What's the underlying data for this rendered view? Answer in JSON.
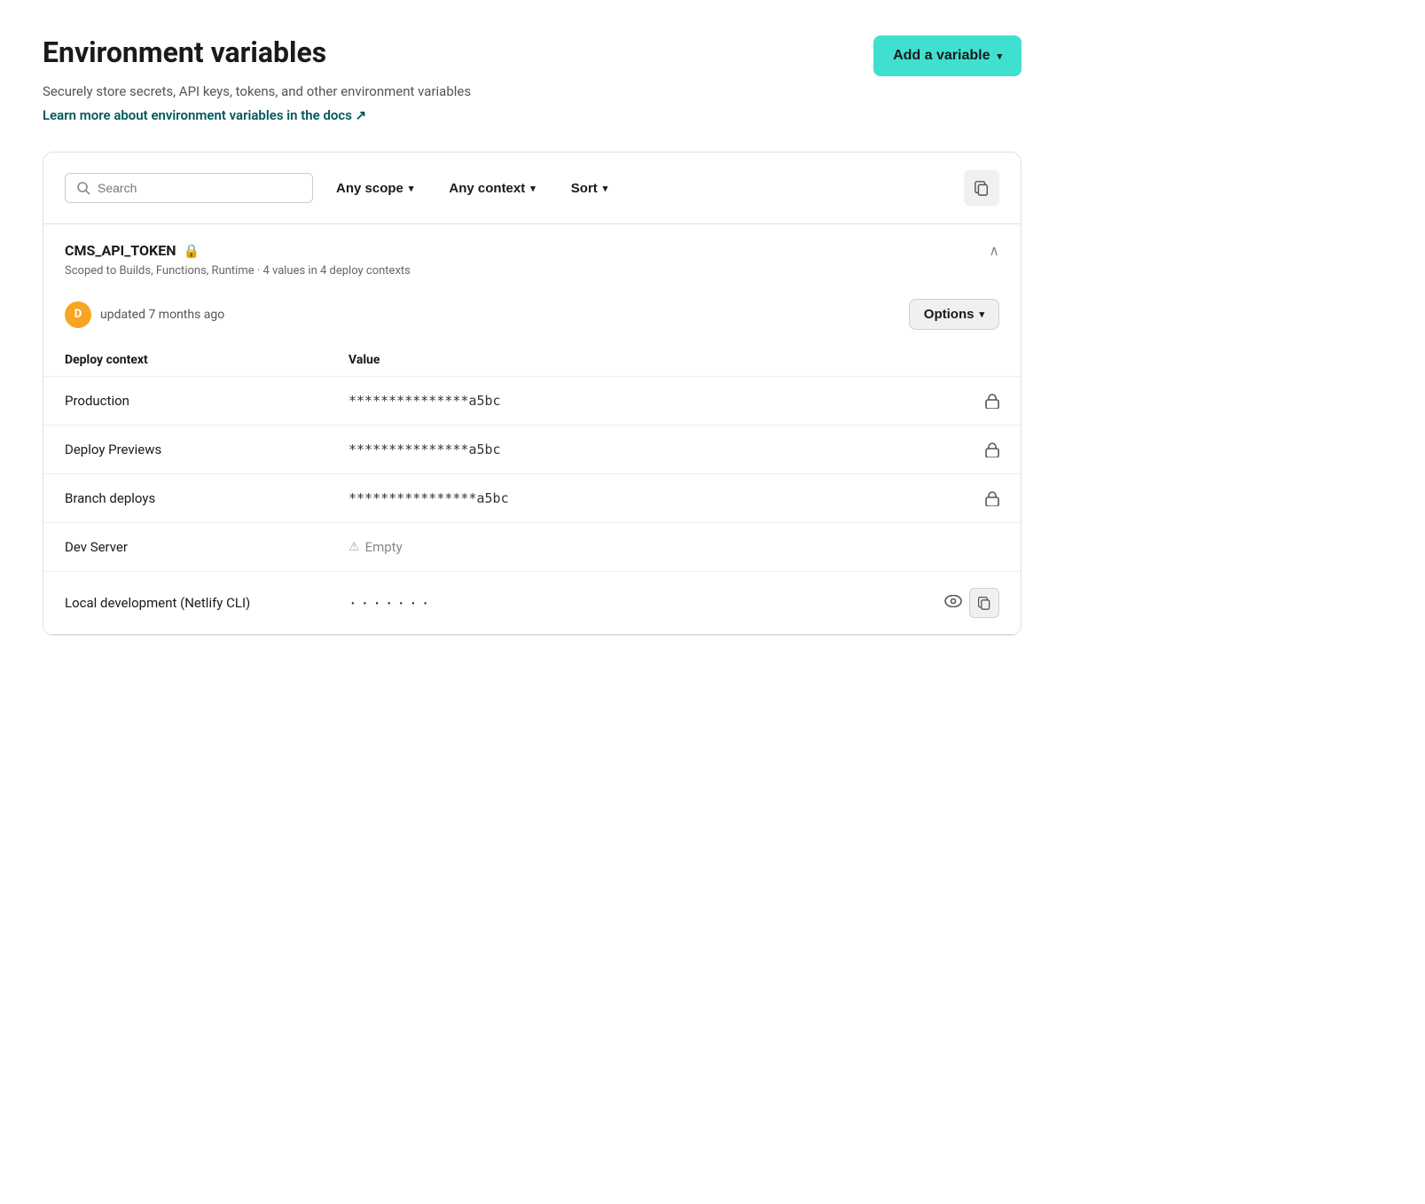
{
  "page": {
    "title": "Environment variables",
    "description": "Securely store secrets, API keys, tokens, and other environment variables",
    "docs_link": "Learn more about environment variables in the docs ↗",
    "add_button": "Add a variable"
  },
  "filter_bar": {
    "search_placeholder": "Search",
    "scope_label": "Any scope",
    "context_label": "Any context",
    "sort_label": "Sort"
  },
  "variable": {
    "name": "CMS_API_TOKEN",
    "meta": "Scoped to Builds, Functions, Runtime · 4 values in 4 deploy contexts",
    "updated_text": "updated 7 months ago",
    "avatar_initial": "D",
    "options_label": "Options",
    "table": {
      "col_context": "Deploy context",
      "col_value": "Value",
      "rows": [
        {
          "context": "Production",
          "value": "***************a5bc",
          "type": "locked"
        },
        {
          "context": "Deploy Previews",
          "value": "***************a5bc",
          "type": "locked"
        },
        {
          "context": "Branch deploys",
          "value": "****************a5bc",
          "type": "locked"
        },
        {
          "context": "Dev Server",
          "value": "",
          "type": "empty",
          "empty_label": "Empty"
        },
        {
          "context": "Local development (Netlify CLI)",
          "value": "·······",
          "type": "local"
        }
      ]
    }
  }
}
